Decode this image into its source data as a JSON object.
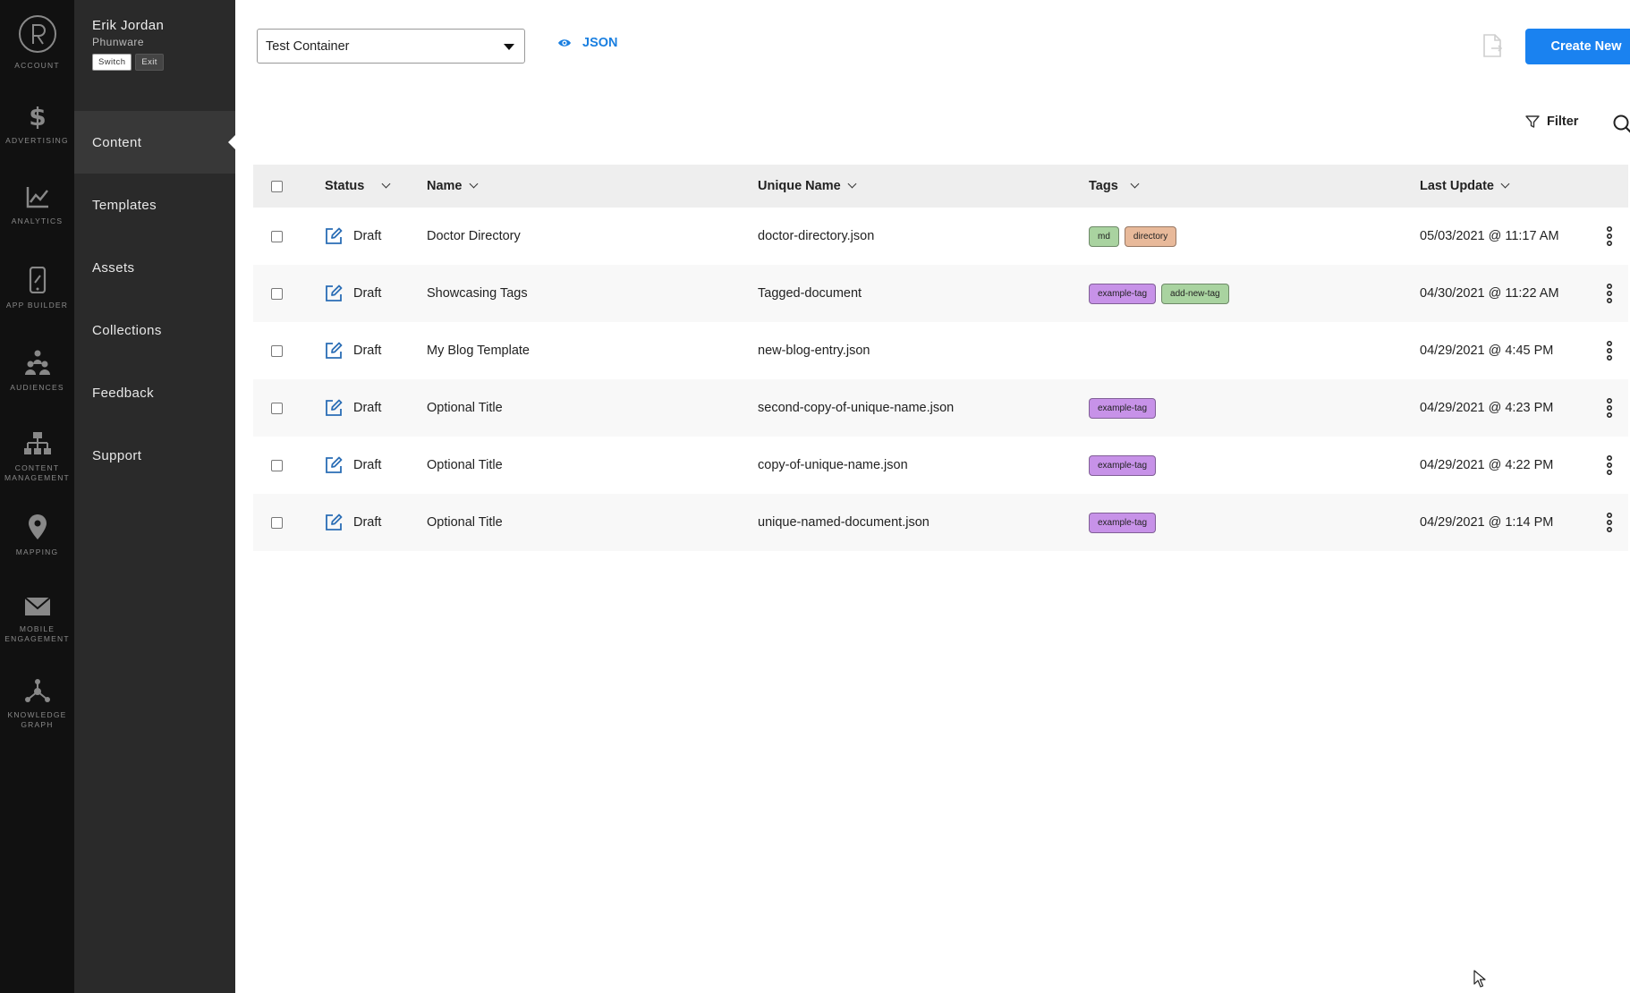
{
  "rail": {
    "items": [
      {
        "label": "ACCOUNT",
        "icon": "account-logo-icon"
      },
      {
        "label": "ADVERTISING",
        "icon": "dollar-icon"
      },
      {
        "label": "ANALYTICS",
        "icon": "chart-line-icon"
      },
      {
        "label": "APP BUILDER",
        "icon": "phone-icon"
      },
      {
        "label": "AUDIENCES",
        "icon": "people-icon"
      },
      {
        "label": "CONTENT MANAGEMENT",
        "icon": "hierarchy-icon"
      },
      {
        "label": "MAPPING",
        "icon": "map-pin-icon"
      },
      {
        "label": "MOBILE ENGAGEMENT",
        "icon": "envelope-icon"
      },
      {
        "label": "KNOWLEDGE GRAPH",
        "icon": "graph-nodes-icon"
      }
    ]
  },
  "user": {
    "name": "Erik Jordan",
    "org": "Phunware",
    "switch_label": "Switch",
    "exit_label": "Exit"
  },
  "subnav": {
    "items": [
      {
        "label": "Content",
        "active": true
      },
      {
        "label": "Templates",
        "active": false
      },
      {
        "label": "Assets",
        "active": false
      },
      {
        "label": "Collections",
        "active": false
      },
      {
        "label": "Feedback",
        "active": false
      },
      {
        "label": "Support",
        "active": false
      }
    ]
  },
  "topbar": {
    "container_select": "Test Container",
    "json_label": "JSON",
    "create_label": "Create New",
    "filter_label": "Filter"
  },
  "colors": {
    "accent": "#1a82f0",
    "tag_md": "#a9d3a0",
    "tag_directory": "#e8b99a",
    "tag_example": "#c792e8",
    "tag_add_new": "#a9d3a0"
  },
  "table": {
    "headers": {
      "status": "Status",
      "name": "Name",
      "unique": "Unique Name",
      "tags": "Tags",
      "date": "Last Update"
    },
    "rows": [
      {
        "status": "Draft",
        "name": "Doctor Directory",
        "unique": "doctor-directory.json",
        "tags": [
          {
            "label": "md",
            "color": "#a9d3a0"
          },
          {
            "label": "directory",
            "color": "#e8b99a"
          }
        ],
        "date": "05/03/2021 @ 11:17 AM"
      },
      {
        "status": "Draft",
        "name": "Showcasing Tags",
        "unique": "Tagged-document",
        "tags": [
          {
            "label": "example-tag",
            "color": "#c792e8"
          },
          {
            "label": "add-new-tag",
            "color": "#a9d3a0"
          }
        ],
        "date": "04/30/2021 @ 11:22 AM"
      },
      {
        "status": "Draft",
        "name": "My Blog Template",
        "unique": "new-blog-entry.json",
        "tags": [],
        "date": "04/29/2021 @ 4:45 PM"
      },
      {
        "status": "Draft",
        "name": "Optional Title",
        "unique": "second-copy-of-unique-name.json",
        "tags": [
          {
            "label": "example-tag",
            "color": "#c792e8"
          }
        ],
        "date": "04/29/2021 @ 4:23 PM"
      },
      {
        "status": "Draft",
        "name": "Optional Title",
        "unique": "copy-of-unique-name.json",
        "tags": [
          {
            "label": "example-tag",
            "color": "#c792e8"
          }
        ],
        "date": "04/29/2021 @ 4:22 PM"
      },
      {
        "status": "Draft",
        "name": "Optional Title",
        "unique": "unique-named-document.json",
        "tags": [
          {
            "label": "example-tag",
            "color": "#c792e8"
          }
        ],
        "date": "04/29/2021 @ 1:14 PM"
      }
    ]
  }
}
